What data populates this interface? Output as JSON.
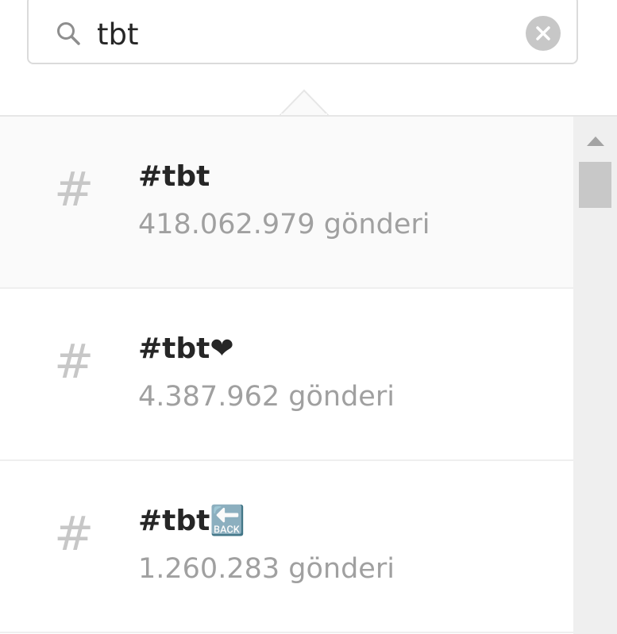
{
  "search": {
    "value": "tbt",
    "search_icon": "search-icon",
    "clear_icon": "clear-icon"
  },
  "results": [
    {
      "icon": "hash-icon",
      "symbol": "#",
      "tag": "#tbt",
      "count": "418.062.979 gönderi"
    },
    {
      "icon": "hash-icon",
      "symbol": "#",
      "tag": "#tbt❤",
      "count": "4.387.962 gönderi"
    },
    {
      "icon": "hash-icon",
      "symbol": "#",
      "tag": "#tbt🔙",
      "count": "1.260.283 gönderi"
    }
  ],
  "scrollbar": {
    "up_icon": "scroll-up-arrow-icon"
  },
  "colors": {
    "border": "#dbdbdb",
    "text_primary": "#262626",
    "text_secondary": "#a0a0a0",
    "icon_gray": "#c7c7c7",
    "active_row": "#fafafa"
  }
}
